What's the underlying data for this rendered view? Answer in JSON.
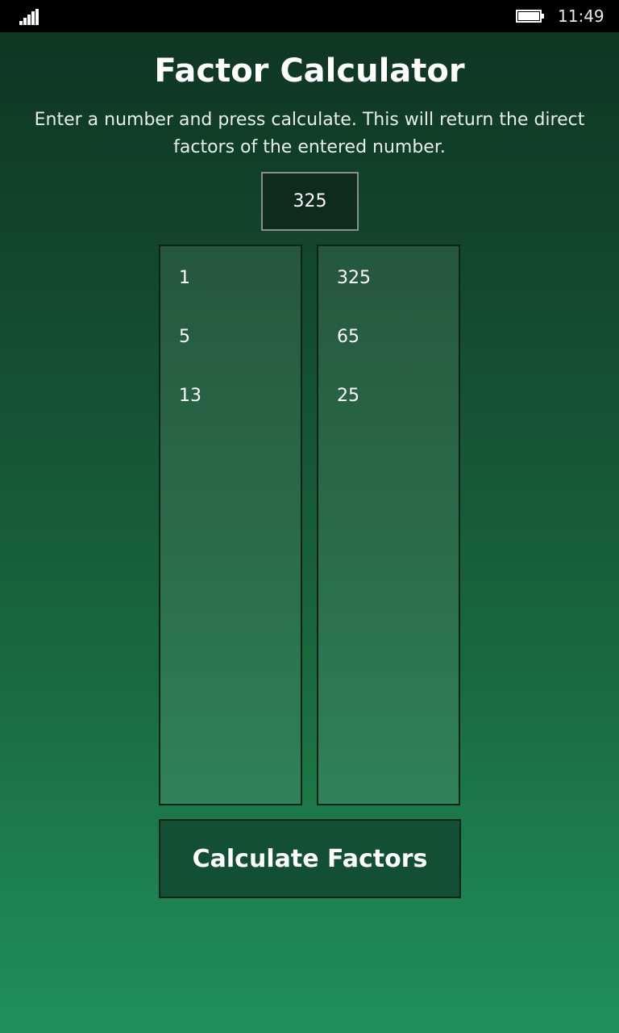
{
  "status_bar": {
    "signal_icon": "signal-bars-icon",
    "battery_icon": "battery-icon",
    "time": "11:49"
  },
  "app": {
    "title": "Factor Calculator",
    "instructions": "Enter a number and press calculate. This will return the direct factors of the entered number.",
    "input_value": "325",
    "button_label": "Calculate Factors"
  },
  "factors": {
    "left": [
      "1",
      "5",
      "13"
    ],
    "right": [
      "325",
      "65",
      "25"
    ]
  },
  "colors": {
    "status_bar_bg": "#000000",
    "background_top": "#0f3322",
    "background_bottom": "#20905a",
    "column_bg": "#2a6a4a",
    "button_bg": "#134f34",
    "text": "#ffffff"
  }
}
